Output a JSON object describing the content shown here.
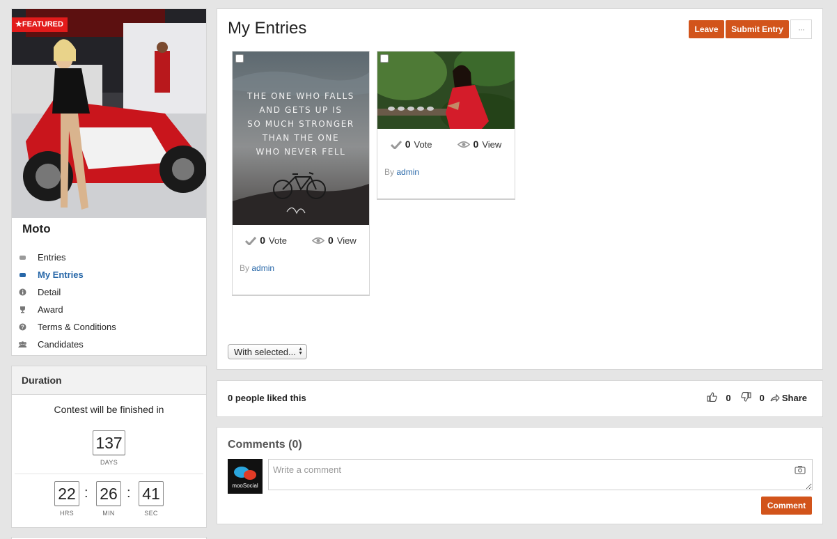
{
  "contest": {
    "featured_label": "FEATURED",
    "title": "Moto",
    "menu": [
      {
        "label": "Entries",
        "icon": "entries-icon"
      },
      {
        "label": "My Entries",
        "icon": "entries-icon",
        "active": true
      },
      {
        "label": "Detail",
        "icon": "info-icon"
      },
      {
        "label": "Award",
        "icon": "trophy-icon"
      },
      {
        "label": "Terms & Conditions",
        "icon": "question-icon"
      },
      {
        "label": "Candidates",
        "icon": "users-icon"
      }
    ]
  },
  "duration": {
    "title": "Duration",
    "finish_text": "Contest will be finished in",
    "days": "137",
    "days_label": "DAYS",
    "hours": "22",
    "hours_label": "HRS",
    "minutes": "26",
    "minutes_label": "MIN",
    "seconds": "41",
    "seconds_label": "SEC",
    "separator": ":"
  },
  "main": {
    "title": "My Entries",
    "leave_label": "Leave",
    "submit_label": "Submit Entry",
    "more_label": "···",
    "entries": [
      {
        "quote": [
          "THE ONE WHO FALLS",
          "AND GETS UP IS",
          "SO MUCH STRONGER",
          "THAN THE ONE",
          "WHO NEVER FELL"
        ],
        "votes": "0",
        "vote_label": "Vote",
        "views": "0",
        "view_label": "View",
        "by_label": "By",
        "author": "admin"
      },
      {
        "votes": "0",
        "vote_label": "Vote",
        "views": "0",
        "view_label": "View",
        "by_label": "By",
        "author": "admin"
      }
    ],
    "bulk_select_label": "With selected..."
  },
  "likes": {
    "text": "0 people liked this",
    "likes_count": "0",
    "dislikes_count": "0",
    "share_label": "Share"
  },
  "comments": {
    "title": "Comments (0)",
    "placeholder": "Write a comment",
    "button_label": "Comment",
    "avatar_brand": "mooSocial"
  },
  "colors": {
    "accent": "#d2541b",
    "link": "#2767a8",
    "featured": "#e21b1b"
  }
}
